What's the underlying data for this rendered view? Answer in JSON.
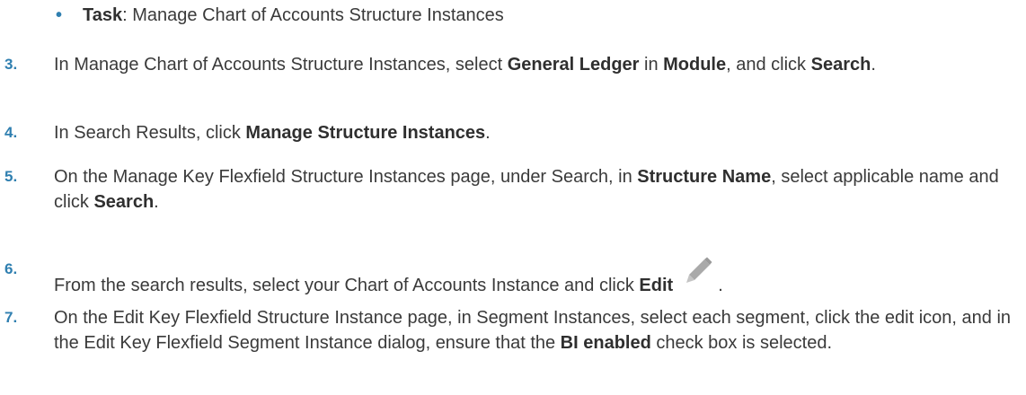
{
  "bullet": {
    "symbol": "•",
    "label": "Task",
    "sep": ": ",
    "text": "Manage Chart of Accounts Structure Instances"
  },
  "steps": [
    {
      "num": "3.",
      "parts": [
        "In Manage Chart of Accounts Structure Instances, select ",
        "General Ledger",
        " in ",
        "Module",
        ", and click ",
        "Search",
        "."
      ]
    },
    {
      "num": "4.",
      "parts": [
        "In Search Results, click ",
        "Manage Structure Instances",
        "."
      ]
    },
    {
      "num": "5.",
      "parts": [
        "On the Manage Key Flexfield Structure Instances page, under Search, in ",
        "Structure Name",
        ", select applicable name and click ",
        "Search",
        "."
      ]
    },
    {
      "num": "6.",
      "parts": [
        "From the search results, select your Chart of Accounts Instance and click ",
        "Edit",
        "."
      ]
    },
    {
      "num": "7.",
      "parts": [
        "On the Edit Key Flexfield Structure Instance page, in Segment Instances, select each segment, click the edit icon, and in the Edit Key Flexfield Segment Instance dialog, ensure that the ",
        "BI enabled",
        " check box is selected."
      ]
    }
  ],
  "icons": {
    "edit": "pencil-icon"
  },
  "colors": {
    "accent": "#2f7fb0",
    "text": "#3a3a3a",
    "icon": "#a9a9a9"
  }
}
